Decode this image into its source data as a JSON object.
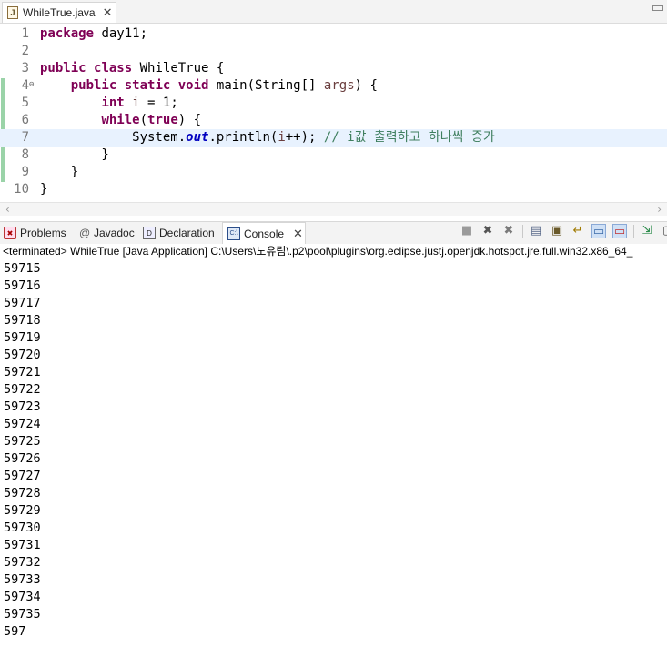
{
  "editor": {
    "tab": {
      "title": "WhileTrue.java",
      "icon": "java-file-icon",
      "close": "✕"
    },
    "current_line": 7,
    "lines": [
      {
        "n": "1",
        "tokens": [
          {
            "t": "package",
            "c": "kw"
          },
          {
            "t": " day11;",
            "c": ""
          }
        ]
      },
      {
        "n": "2",
        "tokens": []
      },
      {
        "n": "3",
        "tokens": [
          {
            "t": "public",
            "c": "kw"
          },
          {
            "t": " ",
            "c": ""
          },
          {
            "t": "class",
            "c": "kw"
          },
          {
            "t": " WhileTrue {",
            "c": ""
          }
        ]
      },
      {
        "n": "4",
        "fold": "⊖",
        "tokens": [
          {
            "t": "    ",
            "c": ""
          },
          {
            "t": "public",
            "c": "kw"
          },
          {
            "t": " ",
            "c": ""
          },
          {
            "t": "static",
            "c": "kw"
          },
          {
            "t": " ",
            "c": ""
          },
          {
            "t": "void",
            "c": "kw"
          },
          {
            "t": " main(String[] ",
            "c": ""
          },
          {
            "t": "args",
            "c": "var"
          },
          {
            "t": ") {",
            "c": ""
          }
        ]
      },
      {
        "n": "5",
        "tokens": [
          {
            "t": "        ",
            "c": ""
          },
          {
            "t": "int",
            "c": "kw"
          },
          {
            "t": " ",
            "c": ""
          },
          {
            "t": "i",
            "c": "var"
          },
          {
            "t": " = 1;",
            "c": ""
          }
        ]
      },
      {
        "n": "6",
        "tokens": [
          {
            "t": "        ",
            "c": ""
          },
          {
            "t": "while",
            "c": "kw"
          },
          {
            "t": "(",
            "c": ""
          },
          {
            "t": "true",
            "c": "kw"
          },
          {
            "t": ") {",
            "c": ""
          }
        ]
      },
      {
        "n": "7",
        "tokens": [
          {
            "t": "            System.",
            "c": ""
          },
          {
            "t": "out",
            "c": "fld"
          },
          {
            "t": ".println(",
            "c": ""
          },
          {
            "t": "i",
            "c": "var"
          },
          {
            "t": "++); ",
            "c": ""
          },
          {
            "t": "// i값 출력하고 하나씩 증가",
            "c": "cm"
          }
        ]
      },
      {
        "n": "8",
        "tokens": [
          {
            "t": "        }",
            "c": ""
          }
        ]
      },
      {
        "n": "9",
        "tokens": [
          {
            "t": "    }",
            "c": ""
          }
        ]
      },
      {
        "n": "10",
        "tokens": [
          {
            "t": "}",
            "c": ""
          }
        ]
      }
    ]
  },
  "views": {
    "tabs": [
      {
        "label": "Problems",
        "icon": "problems-icon",
        "glyph": "✖",
        "active": false
      },
      {
        "label": "Javadoc",
        "icon": "javadoc-icon",
        "glyph": "@",
        "active": false
      },
      {
        "label": "Declaration",
        "icon": "declaration-icon",
        "glyph": "D",
        "active": false
      },
      {
        "label": "Console",
        "icon": "console-icon",
        "glyph": "C:\\",
        "active": true,
        "close": "✕"
      }
    ],
    "toolbar": [
      {
        "name": "terminate-icon",
        "glyph": "■",
        "color": "#9a9a9a"
      },
      {
        "name": "remove-launch-icon",
        "glyph": "✖",
        "color": "#555555"
      },
      {
        "name": "remove-all-terminated-icon",
        "glyph": "✖",
        "color": "#7a7a7a"
      },
      {
        "name": "clear-console-icon",
        "glyph": "▤",
        "color": "#5a6a8a"
      },
      {
        "name": "scroll-lock-icon",
        "glyph": "▣",
        "color": "#6a5a2a"
      },
      {
        "name": "word-wrap-icon",
        "glyph": "↵",
        "color": "#a07a00"
      },
      {
        "name": "show-on-stdout-icon",
        "glyph": "▭",
        "color": "#3a6aa8",
        "pressed": true
      },
      {
        "name": "show-on-stderr-icon",
        "glyph": "▭",
        "color": "#c03030",
        "pressed": true
      },
      {
        "name": "pin-console-icon",
        "glyph": "⇲",
        "color": "#2a8a4a"
      },
      {
        "name": "display-console-icon",
        "glyph": "▢",
        "color": "#555555"
      }
    ]
  },
  "console": {
    "description": "<terminated> WhileTrue [Java Application] C:\\Users\\노유림\\.p2\\pool\\plugins\\org.eclipse.justj.openjdk.hotspot.jre.full.win32.x86_64_",
    "output": [
      "59715",
      "59716",
      "59717",
      "59718",
      "59719",
      "59720",
      "59721",
      "59722",
      "59723",
      "59724",
      "59725",
      "59726",
      "59727",
      "59728",
      "59729",
      "59730",
      "59731",
      "59732",
      "59733",
      "59734",
      "59735",
      "597"
    ]
  },
  "colors": {
    "keyword": "#7f0055",
    "comment": "#3f7f5f",
    "field": "#0000c0",
    "current_line": "#e8f2fe"
  }
}
